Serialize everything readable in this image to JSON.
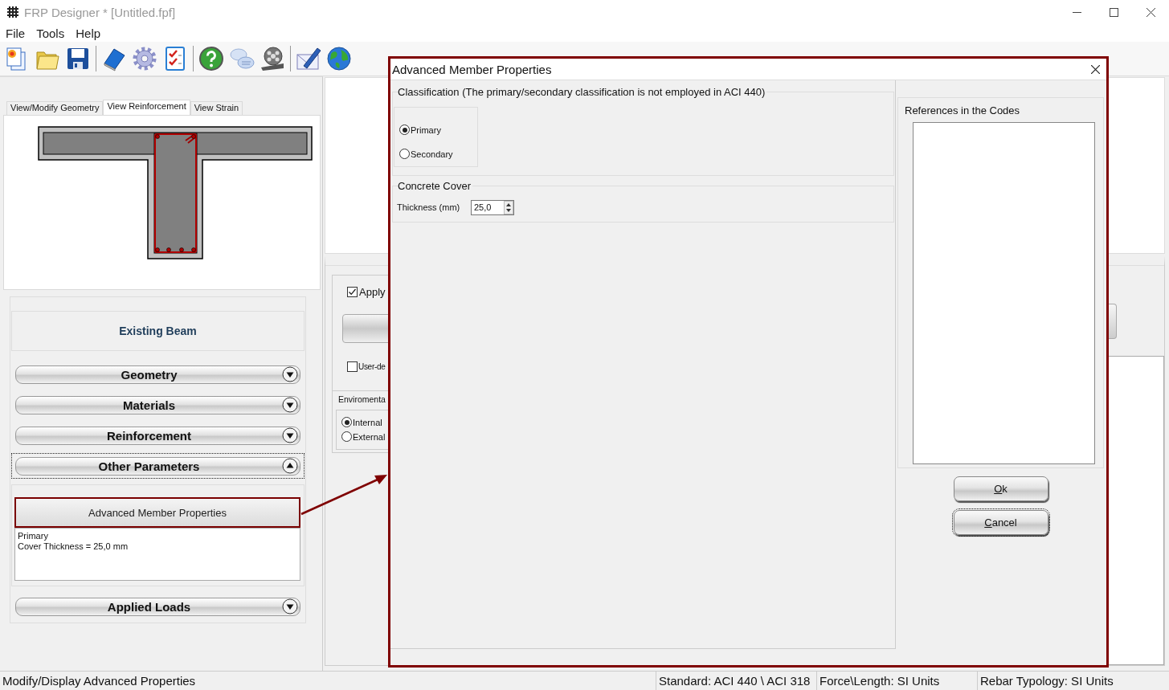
{
  "window": {
    "title": "FRP Designer * [Untitled.fpf]"
  },
  "menu": [
    "File",
    "Tools",
    "Help"
  ],
  "view_tabs": [
    {
      "label": "View/Modify Geometry",
      "selected": false
    },
    {
      "label": "View Reinforcement",
      "selected": true
    },
    {
      "label": "View Strain",
      "selected": false
    }
  ],
  "panel": {
    "title": "Existing Beam",
    "sections": [
      {
        "label": "Geometry",
        "expanded": false,
        "focused": false
      },
      {
        "label": "Materials",
        "expanded": false,
        "focused": false
      },
      {
        "label": "Reinforcement",
        "expanded": false,
        "focused": false
      },
      {
        "label": "Other Parameters",
        "expanded": true,
        "focused": true,
        "button": "Advanced Member Properties",
        "summary": [
          "Primary",
          "Cover Thickness = 25,0 mm"
        ]
      },
      {
        "label": "Applied Loads",
        "expanded": false,
        "focused": false
      }
    ]
  },
  "background_form": {
    "apply": {
      "label": "Apply",
      "checked": true
    },
    "user_defined": {
      "label": "User-de",
      "checked": false
    },
    "environment": {
      "label": "Enviromenta",
      "options": [
        {
          "label": "Internal",
          "selected": true
        },
        {
          "label": "External",
          "selected": false
        }
      ]
    }
  },
  "dialog": {
    "title": "Advanced Member Properties",
    "classification": {
      "label": "Classification (The primary/secondary classification is not employed in ACI 440)",
      "options": [
        {
          "label": "Primary",
          "selected": true
        },
        {
          "label": "Secondary",
          "selected": false
        }
      ]
    },
    "cover": {
      "label": "Concrete Cover",
      "field_label": "Thickness (mm)",
      "value": "25,0"
    },
    "references": {
      "label": "References in the Codes"
    },
    "buttons": [
      {
        "label": "Ok",
        "focused": false
      },
      {
        "label": "Cancel",
        "focused": true
      }
    ]
  },
  "status_bar": [
    "Modify/Display Advanced Properties",
    "Standard: ACI 440 \\ ACI 318",
    "Force\\Length: SI Units",
    "Rebar Typology: SI Units"
  ]
}
